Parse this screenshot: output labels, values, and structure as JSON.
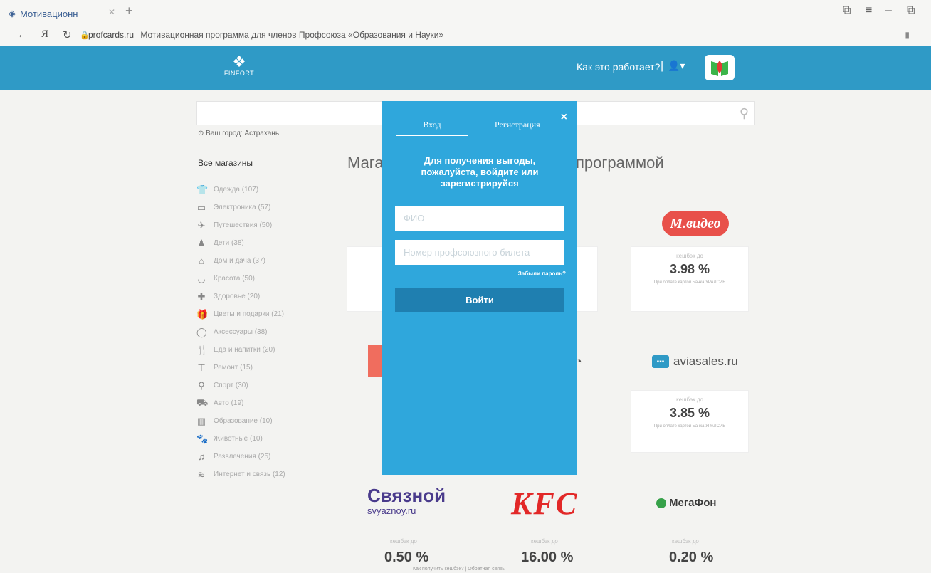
{
  "browser": {
    "tab_title": "Мотивационн",
    "url_domain": "profcards.ru",
    "page_title": "Мотивационная программа для членов Профсоюза «Образования и Науки»"
  },
  "header": {
    "logo_text": "FINFORT",
    "how_it_works": "Как это работает?",
    "separator": "|",
    "brand_color": "#2f9ac6"
  },
  "search": {
    "placeholder": ""
  },
  "city": "Ваш город: Астрахань",
  "categories": {
    "title": "Все магазины",
    "items": [
      {
        "label": "Одежда (107)",
        "icon": "shirt-icon"
      },
      {
        "label": "Электроника (57)",
        "icon": "monitor-icon"
      },
      {
        "label": "Путешествия (50)",
        "icon": "plane-icon"
      },
      {
        "label": "Дети (38)",
        "icon": "child-icon"
      },
      {
        "label": "Дом и дача (37)",
        "icon": "house-icon"
      },
      {
        "label": "Красота (50)",
        "icon": "lips-icon"
      },
      {
        "label": "Здоровье (20)",
        "icon": "medkit-icon"
      },
      {
        "label": "Цветы и подарки (21)",
        "icon": "gift-icon"
      },
      {
        "label": "Аксессуары (38)",
        "icon": "ring-icon"
      },
      {
        "label": "Еда и напитки (20)",
        "icon": "food-icon"
      },
      {
        "label": "Ремонт (15)",
        "icon": "paint-roller-icon"
      },
      {
        "label": "Спорт (30)",
        "icon": "sport-icon"
      },
      {
        "label": "Авто (19)",
        "icon": "car-icon"
      },
      {
        "label": "Образование (10)",
        "icon": "book-icon"
      },
      {
        "label": "Животные (10)",
        "icon": "paw-icon"
      },
      {
        "label": "Развлечения (25)",
        "icon": "music-icon"
      },
      {
        "label": "Интернет и связь (12)",
        "icon": "wifi-icon"
      }
    ]
  },
  "main": {
    "heading_left": "Мага",
    "heading_right": "программой"
  },
  "stores": {
    "cashback_label": "кешбэк до",
    "card_note": "При оплате картой Банка УРАЛСИБ",
    "mvideo": {
      "brand": "М.видео",
      "percent": "3.98 %"
    },
    "aviasales": {
      "brand": "aviasales.ru",
      "percent": "3.85 %"
    },
    "svyaznoy": {
      "brand": "Связной",
      "domain": "svyaznoy.ru",
      "percent": "0.50 %"
    },
    "kfc": {
      "brand": "KFC",
      "percent": "16.00 %"
    },
    "megafon": {
      "brand": "МегаФон",
      "percent": "0.20 %"
    }
  },
  "footer": {
    "link1": "Как получить кешбэк?",
    "separator": "|",
    "link2": "Обратная связь"
  },
  "modal": {
    "tab_login": "Вход",
    "tab_register": "Регистрация",
    "close": "×",
    "prompt": "Для получения выгоды, пожалуйста, войдите или зарегистрируйся",
    "fio_placeholder": "ФИО",
    "ticket_placeholder": "Номер профсоюзного билета",
    "forgot": "Забыли пароль?",
    "submit": "Войти",
    "modal_color": "#2fa7dc"
  }
}
